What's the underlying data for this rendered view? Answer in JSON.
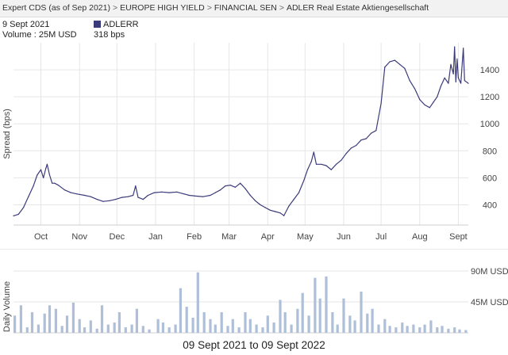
{
  "breadcrumb": [
    "Expert CDS (as of Sep 2021)",
    "EUROPE HIGH YIELD",
    "FINANCIAL SEN",
    "ADLER Real Estate Aktiengesellschaft"
  ],
  "info": {
    "date": "9 Sept 2021",
    "volume_text": "Volume : 25M USD",
    "series_name": "ADLERR",
    "series_value": "318 bps",
    "series_color": "#3b3a7a"
  },
  "footer": "09 Sept 2021 to 09 Sept 2022",
  "chart_data": [
    {
      "type": "line",
      "ylabel": "Spread (bps)",
      "ylim": [
        250,
        1600
      ],
      "yticks": [
        400,
        600,
        800,
        1000,
        1200,
        1400
      ],
      "grid": true,
      "line_color": "#3b3a7a",
      "xlim": [
        "2021-09-09",
        "2022-09-09"
      ],
      "x_ticks": [
        {
          "label": "Oct",
          "date": "2021-10-01"
        },
        {
          "label": "Nov",
          "date": "2021-11-01"
        },
        {
          "label": "Dec",
          "date": "2021-12-01"
        },
        {
          "label": "Jan",
          "date": "2022-01-01"
        },
        {
          "label": "Feb",
          "date": "2022-02-01"
        },
        {
          "label": "Mar",
          "date": "2022-03-01"
        },
        {
          "label": "Apr",
          "date": "2022-04-01"
        },
        {
          "label": "May",
          "date": "2022-05-01"
        },
        {
          "label": "Jun",
          "date": "2022-06-01"
        },
        {
          "label": "Jul",
          "date": "2022-07-01"
        },
        {
          "label": "Aug",
          "date": "2022-08-01"
        },
        {
          "label": "Sept",
          "date": "2022-09-01"
        }
      ],
      "series": [
        {
          "name": "ADLERR",
          "points": [
            [
              "2021-09-09",
              318
            ],
            [
              "2021-09-13",
              330
            ],
            [
              "2021-09-17",
              380
            ],
            [
              "2021-09-21",
              460
            ],
            [
              "2021-09-25",
              540
            ],
            [
              "2021-09-28",
              620
            ],
            [
              "2021-10-01",
              660
            ],
            [
              "2021-10-03",
              600
            ],
            [
              "2021-10-05",
              670
            ],
            [
              "2021-10-06",
              700
            ],
            [
              "2021-10-08",
              620
            ],
            [
              "2021-10-10",
              560
            ],
            [
              "2021-10-12",
              560
            ],
            [
              "2021-10-15",
              545
            ],
            [
              "2021-10-20",
              510
            ],
            [
              "2021-10-25",
              490
            ],
            [
              "2021-10-30",
              480
            ],
            [
              "2021-11-05",
              470
            ],
            [
              "2021-11-10",
              460
            ],
            [
              "2021-11-15",
              440
            ],
            [
              "2021-11-20",
              425
            ],
            [
              "2021-11-25",
              430
            ],
            [
              "2021-11-30",
              440
            ],
            [
              "2021-12-05",
              455
            ],
            [
              "2021-12-10",
              460
            ],
            [
              "2021-12-14",
              470
            ],
            [
              "2021-12-16",
              540
            ],
            [
              "2021-12-18",
              455
            ],
            [
              "2021-12-22",
              440
            ],
            [
              "2021-12-26",
              470
            ],
            [
              "2021-12-31",
              490
            ],
            [
              "2022-01-06",
              495
            ],
            [
              "2022-01-12",
              490
            ],
            [
              "2022-01-18",
              495
            ],
            [
              "2022-01-24",
              480
            ],
            [
              "2022-01-28",
              470
            ],
            [
              "2022-02-02",
              465
            ],
            [
              "2022-02-08",
              460
            ],
            [
              "2022-02-14",
              470
            ],
            [
              "2022-02-18",
              490
            ],
            [
              "2022-02-22",
              510
            ],
            [
              "2022-02-26",
              540
            ],
            [
              "2022-03-02",
              545
            ],
            [
              "2022-03-06",
              530
            ],
            [
              "2022-03-10",
              560
            ],
            [
              "2022-03-14",
              520
            ],
            [
              "2022-03-18",
              470
            ],
            [
              "2022-03-22",
              430
            ],
            [
              "2022-03-26",
              400
            ],
            [
              "2022-03-30",
              380
            ],
            [
              "2022-04-03",
              360
            ],
            [
              "2022-04-07",
              350
            ],
            [
              "2022-04-11",
              340
            ],
            [
              "2022-04-14",
              320
            ],
            [
              "2022-04-18",
              390
            ],
            [
              "2022-04-22",
              440
            ],
            [
              "2022-04-26",
              490
            ],
            [
              "2022-04-30",
              580
            ],
            [
              "2022-05-03",
              660
            ],
            [
              "2022-05-06",
              720
            ],
            [
              "2022-05-08",
              790
            ],
            [
              "2022-05-10",
              700
            ],
            [
              "2022-05-14",
              700
            ],
            [
              "2022-05-18",
              690
            ],
            [
              "2022-05-22",
              660
            ],
            [
              "2022-05-26",
              700
            ],
            [
              "2022-05-30",
              730
            ],
            [
              "2022-06-03",
              780
            ],
            [
              "2022-06-07",
              820
            ],
            [
              "2022-06-11",
              840
            ],
            [
              "2022-06-15",
              880
            ],
            [
              "2022-06-19",
              890
            ],
            [
              "2022-06-23",
              930
            ],
            [
              "2022-06-27",
              950
            ],
            [
              "2022-07-01",
              1150
            ],
            [
              "2022-07-04",
              1420
            ],
            [
              "2022-07-08",
              1460
            ],
            [
              "2022-07-12",
              1470
            ],
            [
              "2022-07-16",
              1440
            ],
            [
              "2022-07-20",
              1410
            ],
            [
              "2022-07-24",
              1320
            ],
            [
              "2022-07-28",
              1260
            ],
            [
              "2022-08-01",
              1180
            ],
            [
              "2022-08-05",
              1140
            ],
            [
              "2022-08-09",
              1120
            ],
            [
              "2022-08-12",
              1160
            ],
            [
              "2022-08-15",
              1200
            ],
            [
              "2022-08-18",
              1280
            ],
            [
              "2022-08-21",
              1340
            ],
            [
              "2022-08-24",
              1300
            ],
            [
              "2022-08-26",
              1440
            ],
            [
              "2022-08-28",
              1370
            ],
            [
              "2022-08-29",
              1570
            ],
            [
              "2022-08-30",
              1310
            ],
            [
              "2022-08-31",
              1480
            ],
            [
              "2022-09-01",
              1340
            ],
            [
              "2022-09-03",
              1300
            ],
            [
              "2022-09-05",
              1560
            ],
            [
              "2022-09-06",
              1320
            ],
            [
              "2022-09-09",
              1300
            ]
          ]
        }
      ]
    },
    {
      "type": "bar",
      "ylabel": "Daily Volume",
      "ylim": [
        0,
        90
      ],
      "unit": "M USD",
      "yticks": [
        {
          "value": 45,
          "label": "45M USD"
        },
        {
          "value": 90,
          "label": "90M USD"
        }
      ],
      "grid": true,
      "bar_color": "#aebfd9",
      "xlim": [
        "2021-09-09",
        "2022-09-09"
      ],
      "bars": [
        [
          "2021-09-10",
          25
        ],
        [
          "2021-09-15",
          40
        ],
        [
          "2021-09-20",
          8
        ],
        [
          "2021-09-24",
          30
        ],
        [
          "2021-09-29",
          12
        ],
        [
          "2021-10-04",
          28
        ],
        [
          "2021-10-08",
          40
        ],
        [
          "2021-10-13",
          35
        ],
        [
          "2021-10-18",
          10
        ],
        [
          "2021-10-22",
          25
        ],
        [
          "2021-10-27",
          44
        ],
        [
          "2021-11-01",
          20
        ],
        [
          "2021-11-05",
          8
        ],
        [
          "2021-11-10",
          18
        ],
        [
          "2021-11-15",
          6
        ],
        [
          "2021-11-19",
          40
        ],
        [
          "2021-11-24",
          12
        ],
        [
          "2021-11-29",
          15
        ],
        [
          "2021-12-03",
          30
        ],
        [
          "2021-12-08",
          8
        ],
        [
          "2021-12-13",
          12
        ],
        [
          "2021-12-17",
          35
        ],
        [
          "2021-12-22",
          10
        ],
        [
          "2021-12-27",
          5
        ],
        [
          "2022-01-03",
          20
        ],
        [
          "2022-01-07",
          15
        ],
        [
          "2022-01-12",
          8
        ],
        [
          "2022-01-17",
          12
        ],
        [
          "2022-01-21",
          65
        ],
        [
          "2022-01-26",
          38
        ],
        [
          "2022-01-31",
          22
        ],
        [
          "2022-02-04",
          88
        ],
        [
          "2022-02-09",
          30
        ],
        [
          "2022-02-14",
          20
        ],
        [
          "2022-02-18",
          12
        ],
        [
          "2022-02-23",
          30
        ],
        [
          "2022-02-28",
          10
        ],
        [
          "2022-03-04",
          20
        ],
        [
          "2022-03-09",
          8
        ],
        [
          "2022-03-14",
          30
        ],
        [
          "2022-03-18",
          20
        ],
        [
          "2022-03-23",
          12
        ],
        [
          "2022-03-28",
          8
        ],
        [
          "2022-04-01",
          25
        ],
        [
          "2022-04-06",
          15
        ],
        [
          "2022-04-11",
          48
        ],
        [
          "2022-04-15",
          30
        ],
        [
          "2022-04-20",
          12
        ],
        [
          "2022-04-25",
          35
        ],
        [
          "2022-04-29",
          58
        ],
        [
          "2022-05-04",
          25
        ],
        [
          "2022-05-09",
          80
        ],
        [
          "2022-05-13",
          50
        ],
        [
          "2022-05-18",
          82
        ],
        [
          "2022-05-23",
          30
        ],
        [
          "2022-05-27",
          12
        ],
        [
          "2022-06-01",
          50
        ],
        [
          "2022-06-06",
          25
        ],
        [
          "2022-06-10",
          18
        ],
        [
          "2022-06-15",
          60
        ],
        [
          "2022-06-20",
          28
        ],
        [
          "2022-06-24",
          35
        ],
        [
          "2022-06-29",
          12
        ],
        [
          "2022-07-04",
          20
        ],
        [
          "2022-07-08",
          10
        ],
        [
          "2022-07-13",
          8
        ],
        [
          "2022-07-18",
          15
        ],
        [
          "2022-07-22",
          10
        ],
        [
          "2022-07-27",
          12
        ],
        [
          "2022-08-01",
          8
        ],
        [
          "2022-08-05",
          12
        ],
        [
          "2022-08-10",
          18
        ],
        [
          "2022-08-15",
          8
        ],
        [
          "2022-08-19",
          10
        ],
        [
          "2022-08-24",
          6
        ],
        [
          "2022-08-29",
          8
        ],
        [
          "2022-09-02",
          5
        ],
        [
          "2022-09-07",
          4
        ]
      ]
    }
  ]
}
